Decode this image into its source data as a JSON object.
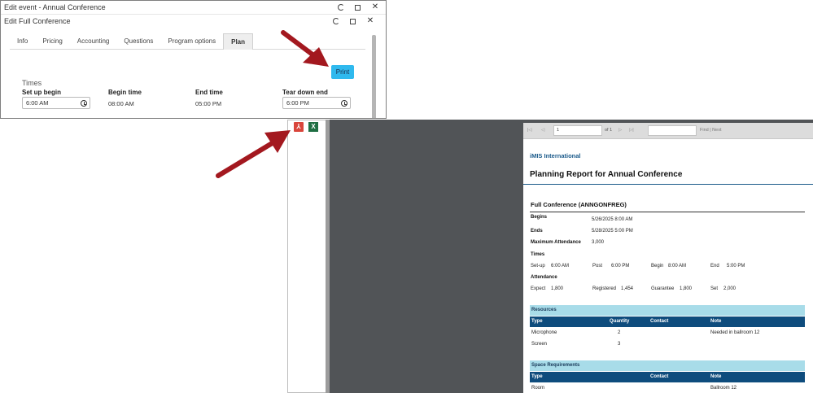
{
  "outer_window": {
    "title": "Edit event - Annual Conference"
  },
  "inner_window": {
    "title": "Edit Full Conference"
  },
  "tabs": [
    {
      "label": "Info"
    },
    {
      "label": "Pricing"
    },
    {
      "label": "Accounting"
    },
    {
      "label": "Questions"
    },
    {
      "label": "Program options"
    },
    {
      "label": "Plan",
      "active": true
    }
  ],
  "plan": {
    "print_label": "Print",
    "times_label": "Times",
    "setup_begin": {
      "label": "Set up begin",
      "value": "6:00 AM"
    },
    "begin_time": {
      "label": "Begin time",
      "value": "08:00 AM"
    },
    "end_time": {
      "label": "End time",
      "value": "05:00 PM"
    },
    "teardown_end": {
      "label": "Tear down end",
      "value": "6:00 PM"
    }
  },
  "export": {
    "pdf_icon": "pdf-icon",
    "excel_icon": "excel-icon",
    "pdf_glyph": "⅄",
    "excel_glyph": "X"
  },
  "viewer_toolbar": {
    "first": "|◁",
    "prev": "◁",
    "page": "1",
    "of": "of 1",
    "next": "▷",
    "last": "▷|",
    "find_next": "Find | Next"
  },
  "report": {
    "org": "iMIS International",
    "title": "Planning Report for Annual Conference",
    "event_title": "Full Conference (ANNGONFREG)",
    "begins_label": "Begins",
    "begins_value": "5/26/2025 8:00 AM",
    "ends_label": "Ends",
    "ends_value": "5/28/2025 5:00 PM",
    "max_att_label": "Maximum Attendance",
    "max_att_value": "3,000",
    "times_label": "Times",
    "times": [
      {
        "label": "Set-up",
        "value": "6:00 AM"
      },
      {
        "label": "Post",
        "value": "6:00 PM"
      },
      {
        "label": "Begin",
        "value": "8:00 AM"
      },
      {
        "label": "End",
        "value": "5:00 PM"
      }
    ],
    "attendance_label": "Attendance",
    "attendance": [
      {
        "label": "Expect",
        "value": "1,800"
      },
      {
        "label": "Registered",
        "value": "1,454"
      },
      {
        "label": "Guarantee",
        "value": "1,800"
      },
      {
        "label": "Set",
        "value": "2,000"
      }
    ],
    "resources": {
      "heading": "Resources",
      "columns": [
        "Type",
        "Quantity",
        "Contact",
        "Note"
      ],
      "rows": [
        {
          "type": "Microphone",
          "quantity": "2",
          "contact": "",
          "note": "Needed in ballroom 12"
        },
        {
          "type": "Screen",
          "quantity": "3",
          "contact": "",
          "note": ""
        }
      ]
    },
    "space": {
      "heading": "Space Requirements",
      "columns": [
        "Type",
        "Contact",
        "Note"
      ],
      "rows": [
        {
          "type": "Room",
          "contact": "",
          "note": "Ballroom 12"
        }
      ]
    }
  },
  "colors": {
    "print_button": "#2fb9ee",
    "arrow": "#a3181f",
    "section_head": "#a8dce9",
    "table_head": "#0e4c7d",
    "viewer_bg": "#515457"
  }
}
